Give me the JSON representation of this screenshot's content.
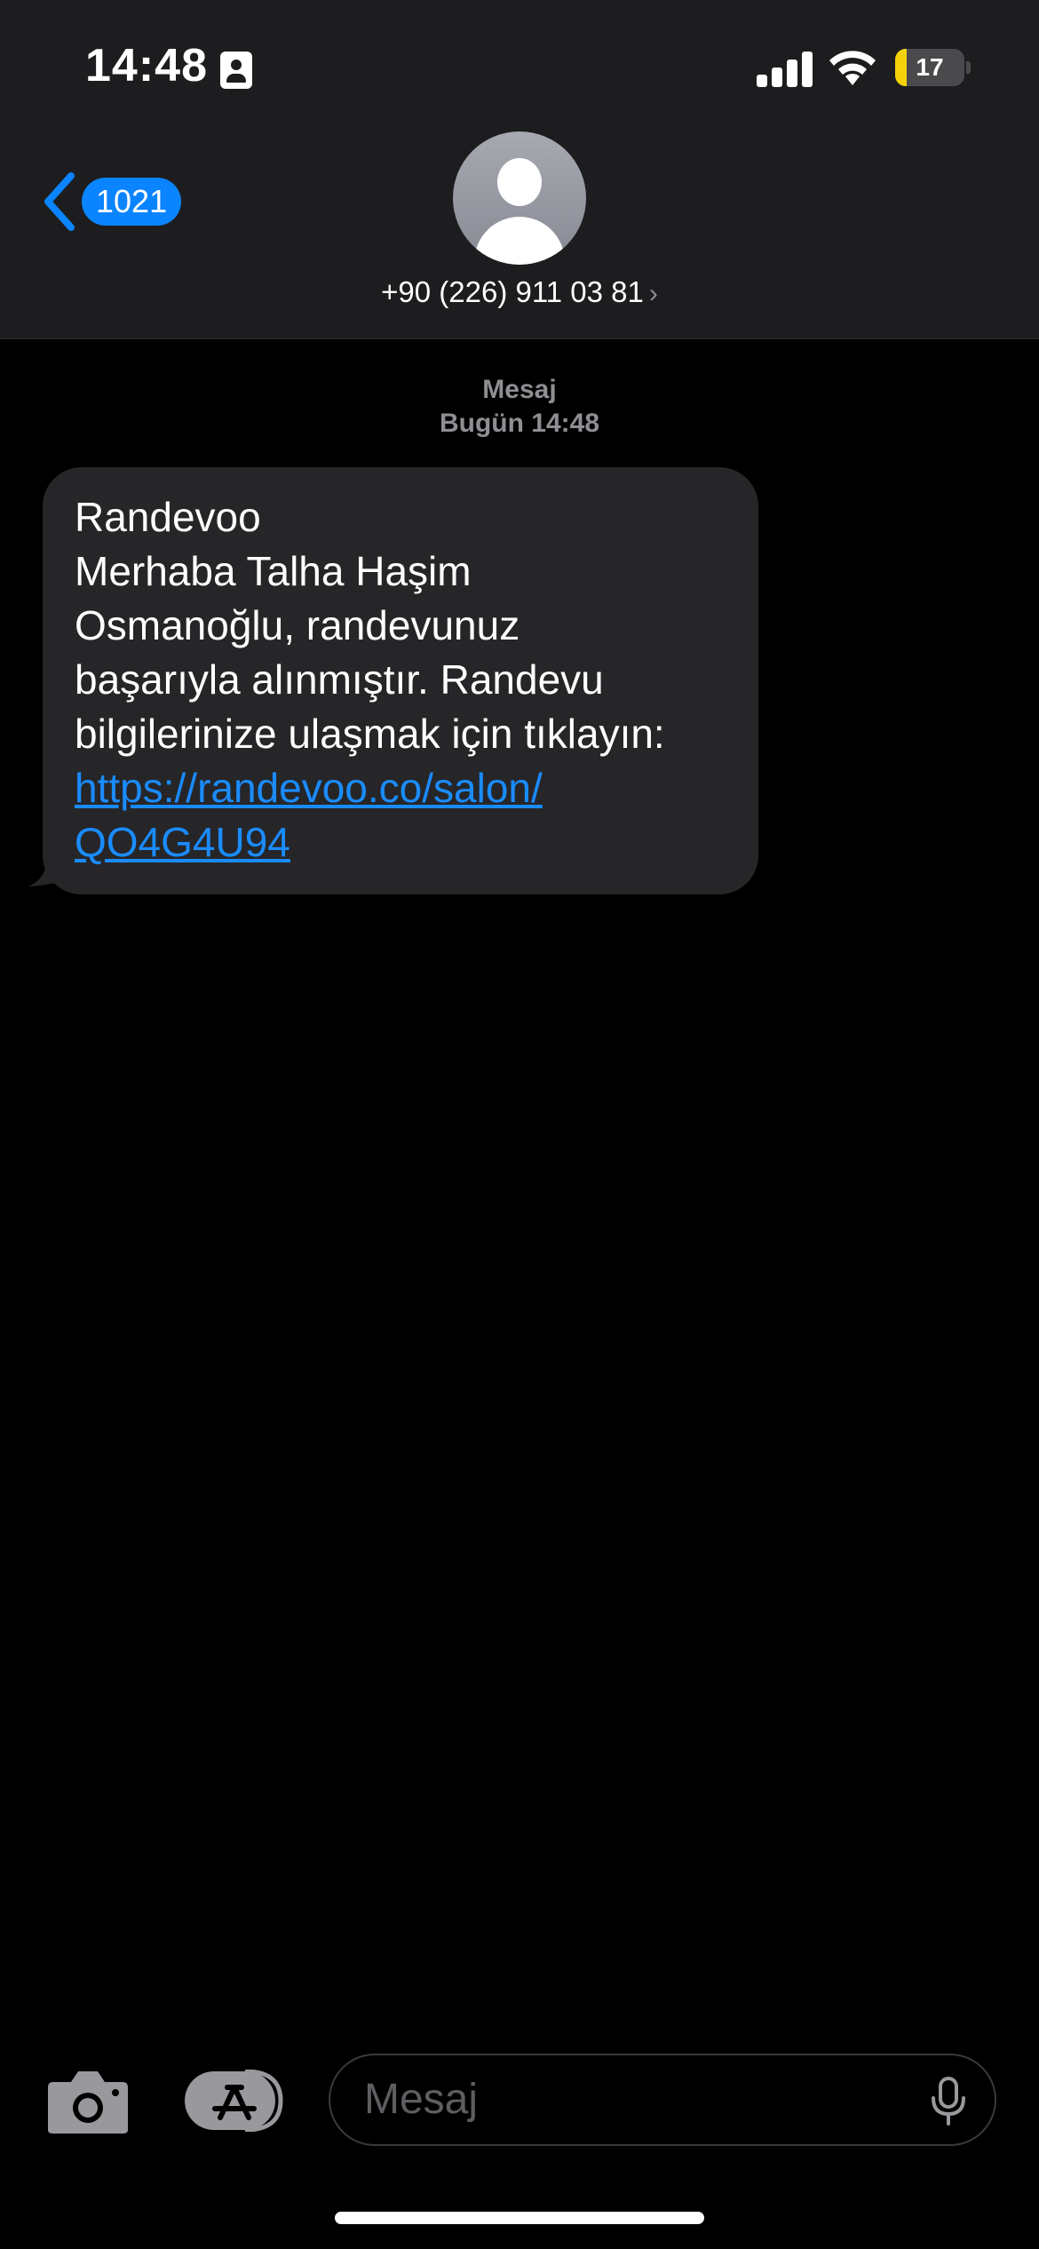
{
  "status_bar": {
    "time": "14:48",
    "battery_percent": "17",
    "battery_level": 0.17,
    "signal_bars": 4,
    "icons": [
      "contact-card-icon",
      "signal-icon",
      "wifi-icon",
      "battery-icon"
    ]
  },
  "header": {
    "back_count": "1021",
    "contact_number": "+90 (226) 911 03 81",
    "contact_chevron": "›"
  },
  "thread": {
    "service_label": "Mesaj",
    "date_label": "Bugün 14:48",
    "messages": [
      {
        "lines": [
          "Randevoo",
          "Merhaba Talha Haşim",
          "Osmanoğlu, randevunuz",
          "başarıyla alınmıştır. Randevu",
          "bilgilerinize ulaşmak için tıklayın:"
        ],
        "link_lines": [
          "https://randevoo.co/salon/",
          "QO4G4U94"
        ]
      }
    ]
  },
  "composer": {
    "placeholder": "Mesaj",
    "icons": [
      "camera-icon",
      "app-store-icon",
      "microphone-icon"
    ]
  },
  "colors": {
    "accent": "#0a84ff",
    "link": "#1a8cff",
    "bubble": "#262629",
    "header_bg": "#1d1d1f",
    "battery_fill": "#f5d30c"
  }
}
